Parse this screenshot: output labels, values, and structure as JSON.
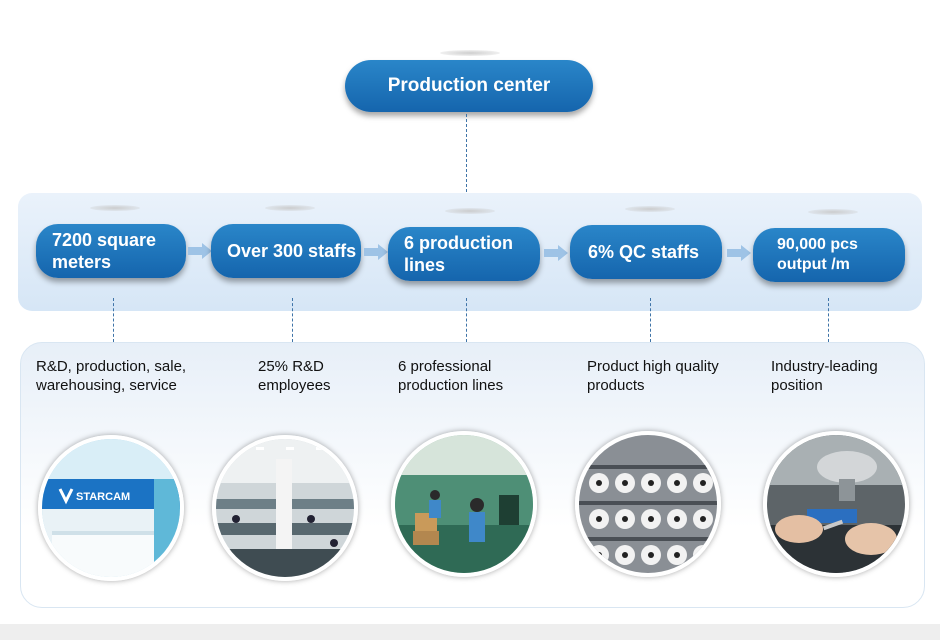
{
  "top": {
    "title": "Production center"
  },
  "stats": [
    {
      "label": "7200 square meters"
    },
    {
      "label": "Over 300 staffs"
    },
    {
      "label": "6 production lines"
    },
    {
      "label": "6% QC staffs"
    },
    {
      "label": "90,000 pcs output /m"
    }
  ],
  "descriptions": [
    {
      "text": "R&D, production, sale, warehousing, service",
      "photo_icon": "office-reception-photo"
    },
    {
      "text": "25% R&D employees",
      "photo_icon": "office-workspace-photo"
    },
    {
      "text": "6 professional production lines",
      "photo_icon": "assembly-line-photo"
    },
    {
      "text": "Product high quality products",
      "photo_icon": "camera-products-photo"
    },
    {
      "text": "Industry-leading position",
      "photo_icon": "microscope-inspection-photo"
    }
  ],
  "logo_text": "STARCAM",
  "colors": {
    "pill": "#1a6fb5",
    "band": "#dde9f6",
    "arrow": "#9ec3e6",
    "connector": "#3f74a8"
  }
}
